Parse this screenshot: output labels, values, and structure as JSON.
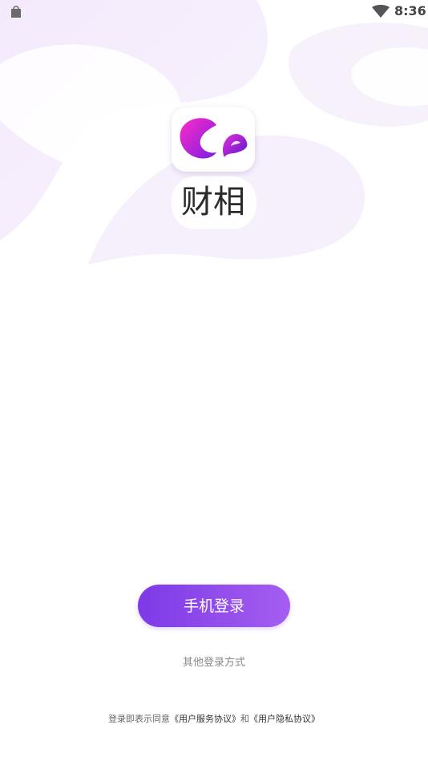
{
  "status_bar": {
    "time": "8:36",
    "left_icon": "shopping-bag-icon",
    "wifi_icon": "wifi-icon"
  },
  "app": {
    "icon_name": "app-logo-icon",
    "wordmark": "财相"
  },
  "login": {
    "phone_login_label": "手机登录",
    "other_methods_label": "其他登录方式"
  },
  "agreement": {
    "prefix": "登录即表示同意",
    "service_link": "《用户服务协议》",
    "conjunction": "和",
    "privacy_link": "《用户隐私协议》"
  },
  "colors": {
    "accent_start": "#7d3ae6",
    "accent_end": "#a55ef0",
    "logo_magenta": "#e020d0",
    "logo_purple": "#6a1fd6",
    "background_tint": "#f3ecfb"
  }
}
